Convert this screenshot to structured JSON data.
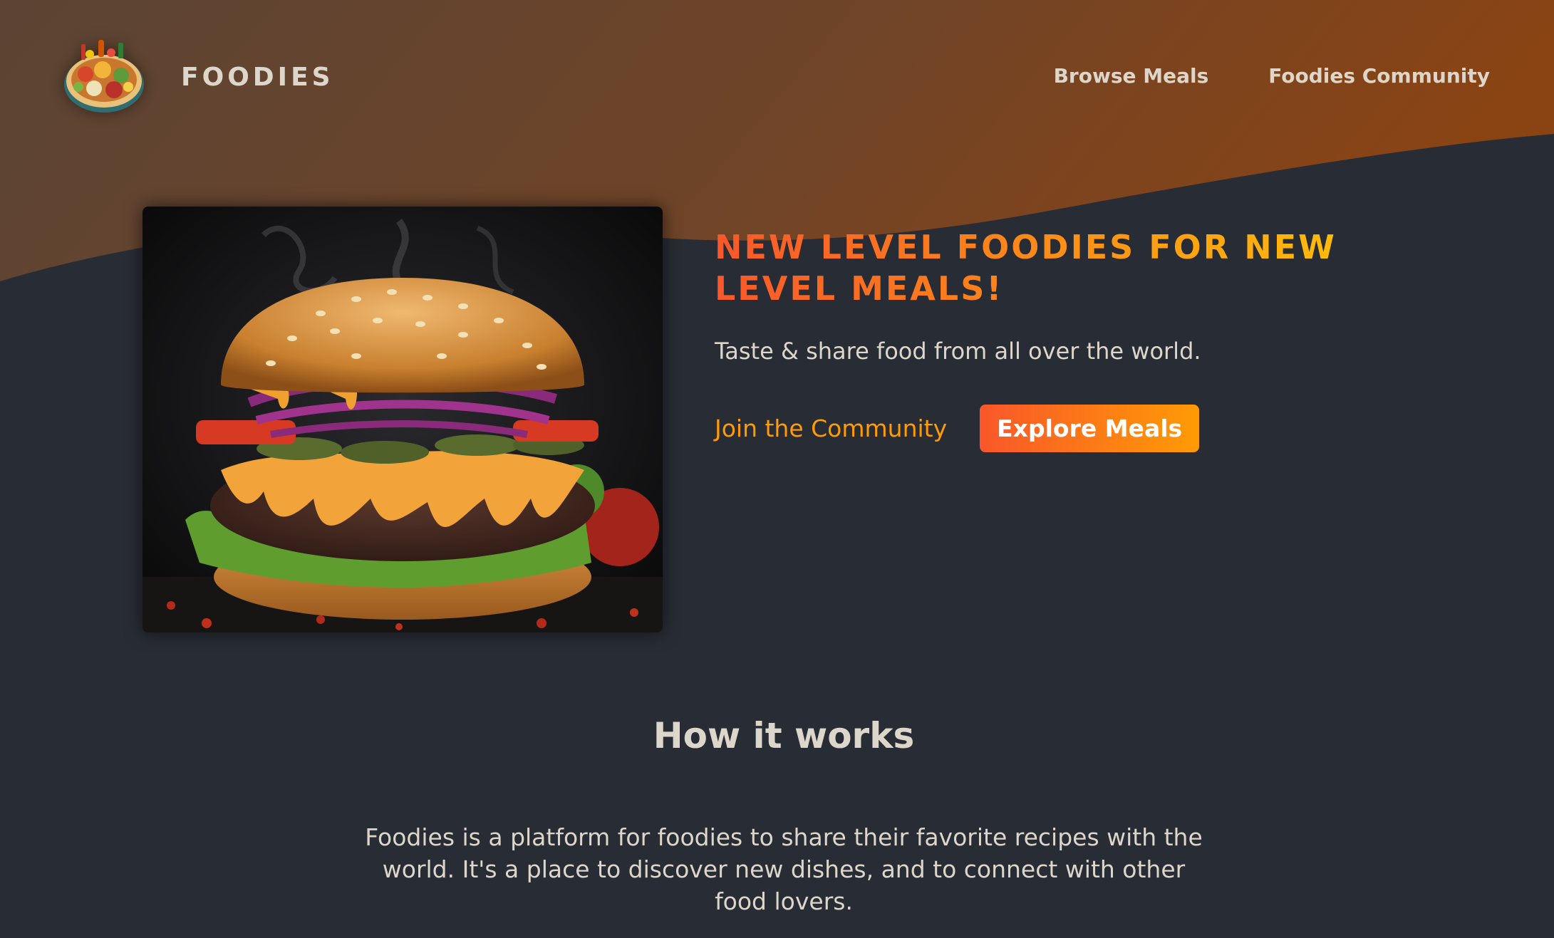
{
  "colors": {
    "background": "#282c34",
    "wave_start": "#5b4434",
    "wave_end": "#8a4414",
    "text": "#ddd6cb",
    "accent_start": "#f9572a",
    "accent_mid": "#ff9b05",
    "accent_end": "#ffc905"
  },
  "header": {
    "logo_alt": "A plate with food on it",
    "logo_text": "FOODIES",
    "nav": {
      "browse_meals": "Browse Meals",
      "community": "Foodies Community"
    }
  },
  "hero": {
    "image_alt": "A delicious, juicy burger",
    "title": "NEW LEVEL FOODIES FOR NEW LEVEL MEALS!",
    "subtitle": "Taste & share food from all over the world.",
    "join_link": "Join the Community",
    "explore_button": "Explore Meals"
  },
  "how_it_works": {
    "heading": "How it works",
    "text": "Foodies is a platform for foodies to share their favorite recipes with the world. It's a place to discover new dishes, and to connect with other food lovers."
  }
}
